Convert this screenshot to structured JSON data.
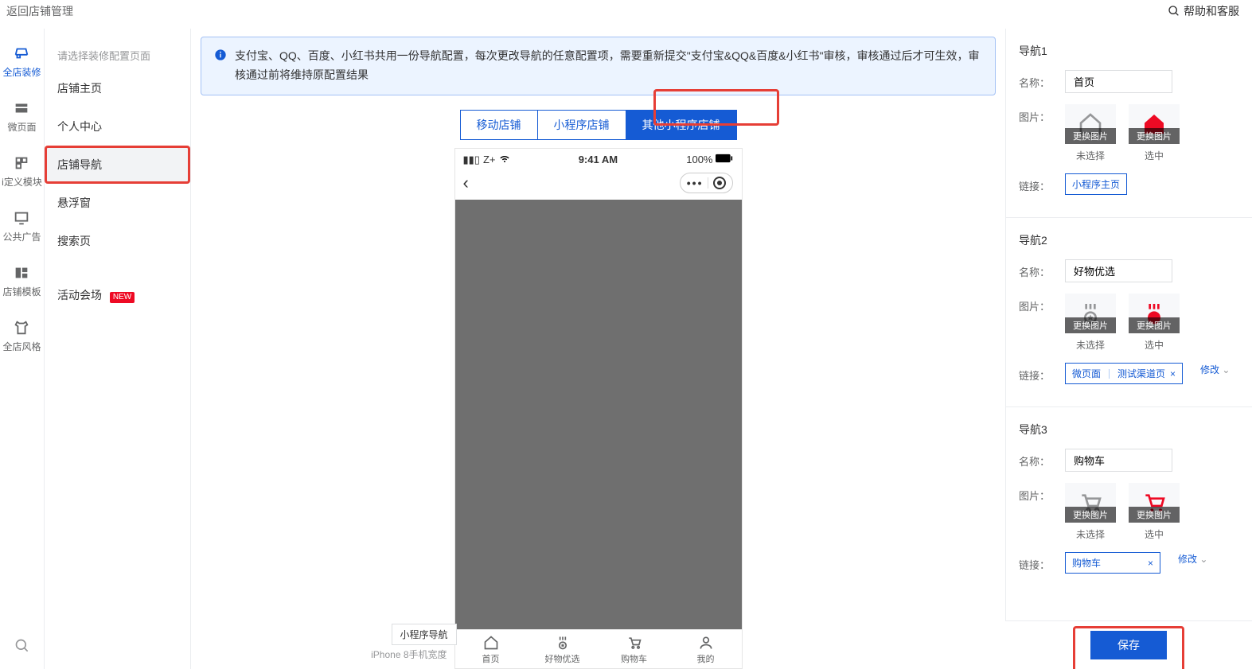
{
  "topbar": {
    "back": "返回店铺管理",
    "help": "帮助和客服"
  },
  "iconrail": {
    "items": [
      "全店装修",
      "微页面",
      "i定义模块",
      "公共广告",
      "店铺模板",
      "全店风格"
    ]
  },
  "sidebar": {
    "hint": "请选择装修配置页面",
    "items": [
      "店铺主页",
      "个人中心",
      "店铺导航",
      "悬浮窗",
      "搜索页"
    ],
    "activity": "活动会场",
    "newtag": "NEW"
  },
  "alert": "支付宝、QQ、百度、小红书共用一份导航配置，每次更改导航的任意配置项，需要重新提交\"支付宝&QQ&百度&小红书\"审核，审核通过后才可生效，审核通过前将维持原配置结果",
  "subtabs": [
    "移动店铺",
    "小程序店铺",
    "其他小程序店铺"
  ],
  "phone": {
    "carrier": "Z+",
    "time": "9:41 AM",
    "battery": "100%",
    "tabs": [
      "首页",
      "好物优选",
      "购物车",
      "我的"
    ],
    "labelTag": "小程序导航",
    "deviceNote": "iPhone 8手机宽度"
  },
  "right": {
    "groups": [
      {
        "title": "导航1",
        "name": "名称：",
        "name_val": "首页",
        "img": "图片：",
        "unsel": "未选择",
        "sel": "选中",
        "change": "更换图片",
        "link": "链接：",
        "link_val": "小程序主页"
      },
      {
        "title": "导航2",
        "name": "名称：",
        "name_val": "好物优选",
        "img": "图片：",
        "unsel": "未选择",
        "sel": "选中",
        "change": "更换图片",
        "link": "链接：",
        "link_seg1": "微页面",
        "link_seg2": "测试渠道页",
        "modify": "修改"
      },
      {
        "title": "导航3",
        "name": "名称：",
        "name_val": "购物车",
        "img": "图片：",
        "unsel": "未选择",
        "sel": "选中",
        "change": "更换图片",
        "link": "链接：",
        "link_val": "购物车",
        "modify": "修改"
      }
    ],
    "save": "保存"
  }
}
